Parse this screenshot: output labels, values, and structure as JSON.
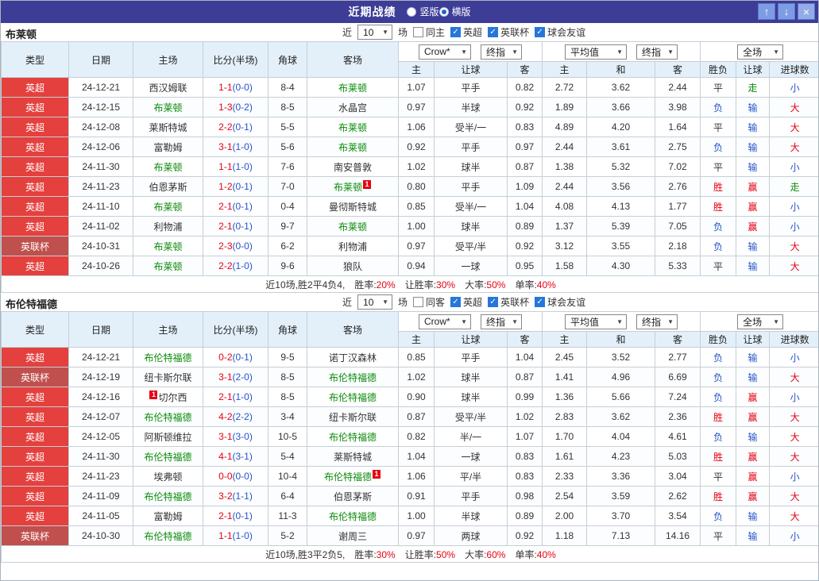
{
  "colors": {
    "titlebar": "#3D3C96",
    "header-bg": "#E3F0FA",
    "epl": "#E4403D",
    "cup": "#C0504D",
    "red": "#E60012",
    "blue": "#2653C9",
    "green": "#0A8A0A",
    "dark": "#333333",
    "btn": "#7E9CE3",
    "btn-close": "#93ACE8"
  },
  "header": {
    "title": "近期战绩",
    "layout_options": [
      {
        "label": "竖版",
        "selected": false
      },
      {
        "label": "横版",
        "selected": true
      }
    ],
    "buttons": {
      "up": "↑",
      "down": "↓",
      "close": "×"
    }
  },
  "table_header": {
    "static_cols": [
      "类型",
      "日期",
      "主场",
      "比分(半场)",
      "角球",
      "客场"
    ],
    "sub_cols": [
      "主",
      "让球",
      "客",
      "主",
      "和",
      "客",
      "胜负",
      "让球",
      "进球数"
    ],
    "selects": {
      "odds_source": "Crow*",
      "odds_period": "终指",
      "euro_source": "平均值",
      "euro_period": "终指",
      "scope": "全场"
    }
  },
  "result_color_map": {
    "胜": "red",
    "负": "blue",
    "平": "dark",
    "赢": "red",
    "输": "blue",
    "走": "green",
    "大": "red",
    "小": "blue"
  },
  "league_color_map": {
    "英超": "epl",
    "英联杯": "cup"
  },
  "sections": [
    {
      "team": "布莱顿",
      "filters": {
        "prefix": "近",
        "count": "10",
        "suffix": "场",
        "checkboxes": [
          {
            "label": "同主",
            "checked": false
          },
          {
            "label": "英超",
            "checked": true
          },
          {
            "label": "英联杯",
            "checked": true
          },
          {
            "label": "球会友谊",
            "checked": true
          }
        ]
      },
      "rows": [
        {
          "league": "英超",
          "date": "24-12-21",
          "home": {
            "name": "西汉姆联"
          },
          "score": {
            "ft": "1-1",
            "ht": "(0-0)"
          },
          "corners": "8-4",
          "away": {
            "name": "布莱顿",
            "focus": true
          },
          "asian": {
            "home": "1.07",
            "line": "平手",
            "away": "0.82"
          },
          "europe": {
            "home": "2.72",
            "draw": "3.62",
            "away": "2.44"
          },
          "results": {
            "outcome": "平",
            "handicap": "走",
            "goals": "小"
          }
        },
        {
          "league": "英超",
          "date": "24-12-15",
          "home": {
            "name": "布莱顿",
            "focus": true
          },
          "score": {
            "ft": "1-3",
            "ht": "(0-2)"
          },
          "corners": "8-5",
          "away": {
            "name": "水晶宫"
          },
          "asian": {
            "home": "0.97",
            "line": "半球",
            "away": "0.92"
          },
          "europe": {
            "home": "1.89",
            "draw": "3.66",
            "away": "3.98"
          },
          "results": {
            "outcome": "负",
            "handicap": "输",
            "goals": "大"
          }
        },
        {
          "league": "英超",
          "date": "24-12-08",
          "home": {
            "name": "莱斯特城"
          },
          "score": {
            "ft": "2-2",
            "ht": "(0-1)"
          },
          "corners": "5-5",
          "away": {
            "name": "布莱顿",
            "focus": true
          },
          "asian": {
            "home": "1.06",
            "line": "受半/一",
            "away": "0.83"
          },
          "europe": {
            "home": "4.89",
            "draw": "4.20",
            "away": "1.64"
          },
          "results": {
            "outcome": "平",
            "handicap": "输",
            "goals": "大"
          }
        },
        {
          "league": "英超",
          "date": "24-12-06",
          "home": {
            "name": "富勒姆"
          },
          "score": {
            "ft": "3-1",
            "ht": "(1-0)"
          },
          "corners": "5-6",
          "away": {
            "name": "布莱顿",
            "focus": true
          },
          "asian": {
            "home": "0.92",
            "line": "平手",
            "away": "0.97"
          },
          "europe": {
            "home": "2.44",
            "draw": "3.61",
            "away": "2.75"
          },
          "results": {
            "outcome": "负",
            "handicap": "输",
            "goals": "大"
          }
        },
        {
          "league": "英超",
          "date": "24-11-30",
          "home": {
            "name": "布莱顿",
            "focus": true
          },
          "score": {
            "ft": "1-1",
            "ht": "(1-0)"
          },
          "corners": "7-6",
          "away": {
            "name": "南安普敦"
          },
          "asian": {
            "home": "1.02",
            "line": "球半",
            "away": "0.87"
          },
          "europe": {
            "home": "1.38",
            "draw": "5.32",
            "away": "7.02"
          },
          "results": {
            "outcome": "平",
            "handicap": "输",
            "goals": "小"
          }
        },
        {
          "league": "英超",
          "date": "24-11-23",
          "home": {
            "name": "伯恩茅斯"
          },
          "score": {
            "ft": "1-2",
            "ht": "(0-1)"
          },
          "corners": "7-0",
          "away": {
            "name": "布莱顿",
            "focus": true,
            "badge": "1",
            "badge_pos": "after"
          },
          "asian": {
            "home": "0.80",
            "line": "平手",
            "away": "1.09"
          },
          "europe": {
            "home": "2.44",
            "draw": "3.56",
            "away": "2.76"
          },
          "results": {
            "outcome": "胜",
            "handicap": "赢",
            "goals": "走"
          }
        },
        {
          "league": "英超",
          "date": "24-11-10",
          "home": {
            "name": "布莱顿",
            "focus": true
          },
          "score": {
            "ft": "2-1",
            "ht": "(0-1)"
          },
          "corners": "0-4",
          "away": {
            "name": "曼彻斯特城"
          },
          "asian": {
            "home": "0.85",
            "line": "受半/一",
            "away": "1.04"
          },
          "europe": {
            "home": "4.08",
            "draw": "4.13",
            "away": "1.77"
          },
          "results": {
            "outcome": "胜",
            "handicap": "赢",
            "goals": "小"
          }
        },
        {
          "league": "英超",
          "date": "24-11-02",
          "home": {
            "name": "利物浦"
          },
          "score": {
            "ft": "2-1",
            "ht": "(0-1)"
          },
          "corners": "9-7",
          "away": {
            "name": "布莱顿",
            "focus": true
          },
          "asian": {
            "home": "1.00",
            "line": "球半",
            "away": "0.89"
          },
          "europe": {
            "home": "1.37",
            "draw": "5.39",
            "away": "7.05"
          },
          "results": {
            "outcome": "负",
            "handicap": "赢",
            "goals": "小"
          }
        },
        {
          "league": "英联杯",
          "date": "24-10-31",
          "home": {
            "name": "布莱顿",
            "focus": true
          },
          "score": {
            "ft": "2-3",
            "ht": "(0-0)"
          },
          "corners": "6-2",
          "away": {
            "name": "利物浦"
          },
          "asian": {
            "home": "0.97",
            "line": "受平/半",
            "away": "0.92"
          },
          "europe": {
            "home": "3.12",
            "draw": "3.55",
            "away": "2.18"
          },
          "results": {
            "outcome": "负",
            "handicap": "输",
            "goals": "大"
          }
        },
        {
          "league": "英超",
          "date": "24-10-26",
          "home": {
            "name": "布莱顿",
            "focus": true
          },
          "score": {
            "ft": "2-2",
            "ht": "(1-0)"
          },
          "corners": "9-6",
          "away": {
            "name": "狼队"
          },
          "asian": {
            "home": "0.94",
            "line": "一球",
            "away": "0.95"
          },
          "europe": {
            "home": "1.58",
            "draw": "4.30",
            "away": "5.33"
          },
          "results": {
            "outcome": "平",
            "handicap": "输",
            "goals": "大"
          }
        }
      ],
      "summary": {
        "prefix": "近10场,胜2平4负4,",
        "stats": [
          {
            "label": "胜率:",
            "value": "20%"
          },
          {
            "label": "让胜率:",
            "value": "30%"
          },
          {
            "label": "大率:",
            "value": "50%"
          },
          {
            "label": "单率:",
            "value": "40%"
          }
        ]
      }
    },
    {
      "team": "布伦特福德",
      "filters": {
        "prefix": "近",
        "count": "10",
        "suffix": "场",
        "checkboxes": [
          {
            "label": "同客",
            "checked": false
          },
          {
            "label": "英超",
            "checked": true
          },
          {
            "label": "英联杯",
            "checked": true
          },
          {
            "label": "球会友谊",
            "checked": true
          }
        ]
      },
      "rows": [
        {
          "league": "英超",
          "date": "24-12-21",
          "home": {
            "name": "布伦特福德",
            "focus": true
          },
          "score": {
            "ft": "0-2",
            "ht": "(0-1)"
          },
          "corners": "9-5",
          "away": {
            "name": "诺丁汉森林"
          },
          "asian": {
            "home": "0.85",
            "line": "平手",
            "away": "1.04"
          },
          "europe": {
            "home": "2.45",
            "draw": "3.52",
            "away": "2.77"
          },
          "results": {
            "outcome": "负",
            "handicap": "输",
            "goals": "小"
          }
        },
        {
          "league": "英联杯",
          "date": "24-12-19",
          "home": {
            "name": "纽卡斯尔联"
          },
          "score": {
            "ft": "3-1",
            "ht": "(2-0)"
          },
          "corners": "8-5",
          "away": {
            "name": "布伦特福德",
            "focus": true
          },
          "asian": {
            "home": "1.02",
            "line": "球半",
            "away": "0.87"
          },
          "europe": {
            "home": "1.41",
            "draw": "4.96",
            "away": "6.69"
          },
          "results": {
            "outcome": "负",
            "handicap": "输",
            "goals": "大"
          }
        },
        {
          "league": "英超",
          "date": "24-12-16",
          "home": {
            "name": "切尔西",
            "badge": "1",
            "badge_pos": "before"
          },
          "score": {
            "ft": "2-1",
            "ht": "(1-0)"
          },
          "corners": "8-5",
          "away": {
            "name": "布伦特福德",
            "focus": true
          },
          "asian": {
            "home": "0.90",
            "line": "球半",
            "away": "0.99"
          },
          "europe": {
            "home": "1.36",
            "draw": "5.66",
            "away": "7.24"
          },
          "results": {
            "outcome": "负",
            "handicap": "赢",
            "goals": "小"
          }
        },
        {
          "league": "英超",
          "date": "24-12-07",
          "home": {
            "name": "布伦特福德",
            "focus": true
          },
          "score": {
            "ft": "4-2",
            "ht": "(2-2)"
          },
          "corners": "3-4",
          "away": {
            "name": "纽卡斯尔联"
          },
          "asian": {
            "home": "0.87",
            "line": "受平/半",
            "away": "1.02"
          },
          "europe": {
            "home": "2.83",
            "draw": "3.62",
            "away": "2.36"
          },
          "results": {
            "outcome": "胜",
            "handicap": "赢",
            "goals": "大"
          }
        },
        {
          "league": "英超",
          "date": "24-12-05",
          "home": {
            "name": "阿斯顿维拉"
          },
          "score": {
            "ft": "3-1",
            "ht": "(3-0)"
          },
          "corners": "10-5",
          "away": {
            "name": "布伦特福德",
            "focus": true
          },
          "asian": {
            "home": "0.82",
            "line": "半/一",
            "away": "1.07"
          },
          "europe": {
            "home": "1.70",
            "draw": "4.04",
            "away": "4.61"
          },
          "results": {
            "outcome": "负",
            "handicap": "输",
            "goals": "大"
          }
        },
        {
          "league": "英超",
          "date": "24-11-30",
          "home": {
            "name": "布伦特福德",
            "focus": true
          },
          "score": {
            "ft": "4-1",
            "ht": "(3-1)"
          },
          "corners": "5-4",
          "away": {
            "name": "莱斯特城"
          },
          "asian": {
            "home": "1.04",
            "line": "一球",
            "away": "0.83"
          },
          "europe": {
            "home": "1.61",
            "draw": "4.23",
            "away": "5.03"
          },
          "results": {
            "outcome": "胜",
            "handicap": "赢",
            "goals": "大"
          }
        },
        {
          "league": "英超",
          "date": "24-11-23",
          "home": {
            "name": "埃弗顿"
          },
          "score": {
            "ft": "0-0",
            "ht": "(0-0)"
          },
          "corners": "10-4",
          "away": {
            "name": "布伦特福德",
            "focus": true,
            "badge": "1",
            "badge_pos": "after"
          },
          "asian": {
            "home": "1.06",
            "line": "平/半",
            "away": "0.83"
          },
          "europe": {
            "home": "2.33",
            "draw": "3.36",
            "away": "3.04"
          },
          "results": {
            "outcome": "平",
            "handicap": "赢",
            "goals": "小"
          }
        },
        {
          "league": "英超",
          "date": "24-11-09",
          "home": {
            "name": "布伦特福德",
            "focus": true
          },
          "score": {
            "ft": "3-2",
            "ht": "(1-1)"
          },
          "corners": "6-4",
          "away": {
            "name": "伯恩茅斯"
          },
          "asian": {
            "home": "0.91",
            "line": "平手",
            "away": "0.98"
          },
          "europe": {
            "home": "2.54",
            "draw": "3.59",
            "away": "2.62"
          },
          "results": {
            "outcome": "胜",
            "handicap": "赢",
            "goals": "大"
          }
        },
        {
          "league": "英超",
          "date": "24-11-05",
          "home": {
            "name": "富勒姆"
          },
          "score": {
            "ft": "2-1",
            "ht": "(0-1)"
          },
          "corners": "11-3",
          "away": {
            "name": "布伦特福德",
            "focus": true
          },
          "asian": {
            "home": "1.00",
            "line": "半球",
            "away": "0.89"
          },
          "europe": {
            "home": "2.00",
            "draw": "3.70",
            "away": "3.54"
          },
          "results": {
            "outcome": "负",
            "handicap": "输",
            "goals": "大"
          }
        },
        {
          "league": "英联杯",
          "date": "24-10-30",
          "home": {
            "name": "布伦特福德",
            "focus": true
          },
          "score": {
            "ft": "1-1",
            "ht": "(1-0)"
          },
          "corners": "5-2",
          "away": {
            "name": "谢周三"
          },
          "asian": {
            "home": "0.97",
            "line": "两球",
            "away": "0.92"
          },
          "europe": {
            "home": "1.18",
            "draw": "7.13",
            "away": "14.16"
          },
          "results": {
            "outcome": "平",
            "handicap": "输",
            "goals": "小"
          }
        }
      ],
      "summary": {
        "prefix": "近10场,胜3平2负5,",
        "stats": [
          {
            "label": "胜率:",
            "value": "30%"
          },
          {
            "label": "让胜率:",
            "value": "50%"
          },
          {
            "label": "大率:",
            "value": "60%"
          },
          {
            "label": "单率:",
            "value": "40%"
          }
        ]
      }
    }
  ]
}
